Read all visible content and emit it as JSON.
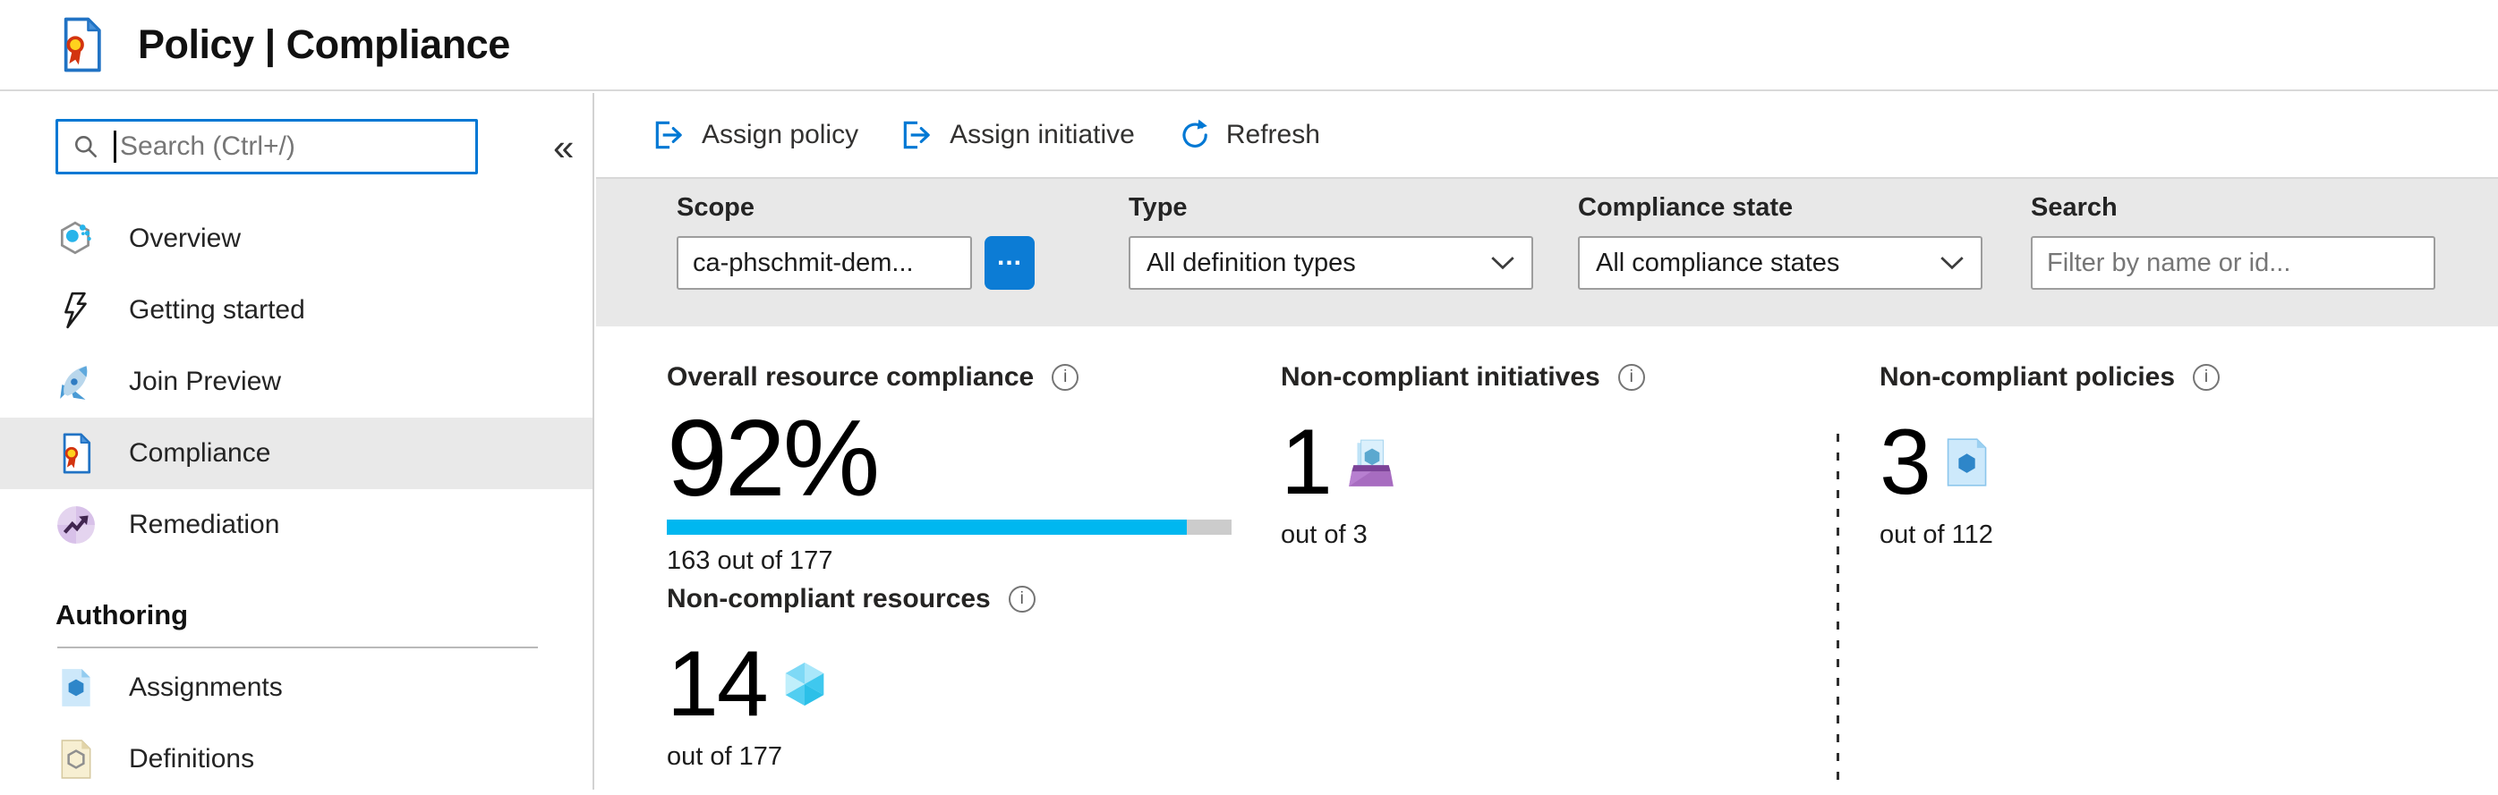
{
  "header": {
    "app_title": "Policy | Compliance"
  },
  "sidebar": {
    "search_placeholder": "Search (Ctrl+/)",
    "collapse_glyph": "«",
    "items": [
      {
        "label": "Overview",
        "icon": "overview-icon"
      },
      {
        "label": "Getting started",
        "icon": "lightning-bolt-icon"
      },
      {
        "label": "Join Preview",
        "icon": "rocket-icon"
      },
      {
        "label": "Compliance",
        "icon": "policy-ribbon-icon",
        "selected": true
      },
      {
        "label": "Remediation",
        "icon": "trend-arrow-icon"
      }
    ],
    "section_header": "Authoring",
    "authoring_items": [
      {
        "label": "Assignments",
        "icon": "assignment-doc-icon"
      },
      {
        "label": "Definitions",
        "icon": "definition-doc-icon"
      }
    ]
  },
  "toolbar": {
    "assign_policy": "Assign policy",
    "assign_initiative": "Assign initiative",
    "refresh": "Refresh"
  },
  "filters": {
    "scope": {
      "label": "Scope",
      "value": "ca-phschmit-dem...",
      "more_label": "..."
    },
    "type": {
      "label": "Type",
      "value": "All definition types"
    },
    "compliance_state": {
      "label": "Compliance state",
      "value": "All compliance states"
    },
    "search": {
      "label": "Search",
      "placeholder": "Filter by name or id..."
    }
  },
  "stats": {
    "info_glyph": "i",
    "overall": {
      "title": "Overall resource compliance",
      "value": "92%",
      "percent": 92,
      "detail": "163 out of 177",
      "progress_style": "width:92%"
    },
    "initiatives": {
      "title": "Non-compliant initiatives",
      "value": "1",
      "detail": "out of 3"
    },
    "policies": {
      "title": "Non-compliant policies",
      "value": "3",
      "detail": "out of 112"
    },
    "resources": {
      "title": "Non-compliant resources",
      "value": "14",
      "detail": "out of 177"
    }
  },
  "colors": {
    "accent": "#0078d4",
    "progress_fill": "#00b7f0",
    "progress_track": "#cccccc",
    "filter_bar_bg": "#e8e8e8",
    "selected_item_bg": "#e9e9e9"
  }
}
